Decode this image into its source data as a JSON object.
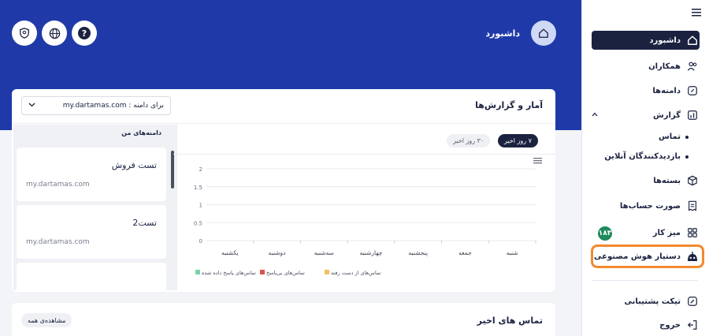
{
  "header": {
    "title": "داشبورد"
  },
  "sidebar": {
    "items": [
      {
        "label": "داشبورد"
      },
      {
        "label": "همکاران"
      },
      {
        "label": "دامنه‌ها"
      },
      {
        "label": "گزارش"
      },
      {
        "label": "بسته‌ها"
      },
      {
        "label": "صورت حساب‌ها"
      },
      {
        "label": "میز کار"
      },
      {
        "label": "دستیار هوش مصنوعی"
      },
      {
        "label": "تیکت پشتیبانی"
      },
      {
        "label": "خروج"
      }
    ],
    "subitems": [
      {
        "label": "تماس"
      },
      {
        "label": "بازدیدکنندگان آنلاین"
      }
    ],
    "badge": "۱۸۳"
  },
  "stats": {
    "title": "آمار و گزارش‌ها",
    "domain_label": "برای دامنه :",
    "domain_value": "my.dartamas.com",
    "domains_heading": "دامنه‌های من",
    "domains": [
      {
        "name": "تست فروش",
        "url": "my.dartamas.com"
      },
      {
        "name": "تست2",
        "url": "my.dartamas.com"
      }
    ],
    "range_7": "۷ روز اخیر",
    "range_30": "۳۰ روز اخیر"
  },
  "chart_data": {
    "type": "bar",
    "categories": [
      "شنبه",
      "جمعه",
      "پنجشنبه",
      "چهارشنبه",
      "سه‌شنبه",
      "دوشنبه",
      "یکشنبه"
    ],
    "yticks": [
      "0",
      "0.5",
      "1",
      "1.5",
      "2"
    ],
    "ylim": [
      0,
      2
    ],
    "grid": true,
    "legend_position": "bottom",
    "series": [
      {
        "name": "تماس‌های پاسخ داده شده",
        "color": "#7dd3a8",
        "values": [
          0,
          0,
          0,
          0,
          0,
          0,
          0
        ]
      },
      {
        "name": "تماس‌های بی‌پاسخ",
        "color": "#d9534f",
        "values": [
          0,
          0,
          0,
          0,
          0,
          0,
          0
        ]
      },
      {
        "name": "تماس‌های از دست رفته",
        "color": "#f0c060",
        "values": [
          0,
          0,
          0,
          0,
          0,
          0,
          0
        ]
      }
    ]
  },
  "recent": {
    "title": "تماس های اخیر",
    "see_all": "مشاهده‌ی همه"
  },
  "colors": {
    "primary": "#1f3aa8",
    "dark": "#1b2240",
    "highlight": "#f28a2e",
    "badge": "#1f8a5b"
  }
}
